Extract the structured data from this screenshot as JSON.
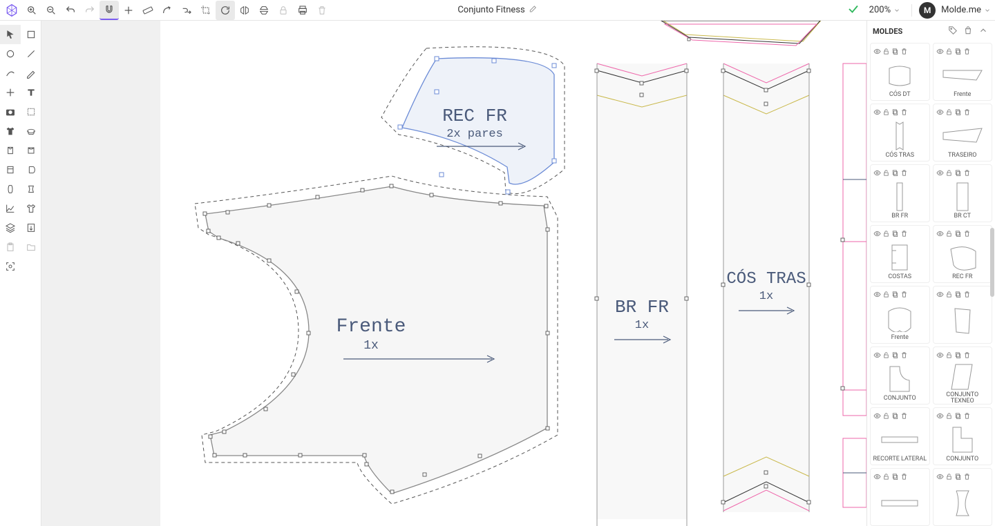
{
  "header": {
    "title": "Conjunto Fitness",
    "zoom": "200%",
    "avatar_initial": "M",
    "brand": "Molde.me"
  },
  "canvas": {
    "rec_fr_title": "REC FR",
    "rec_fr_sub": "2x pares",
    "frente_title": "Frente",
    "frente_sub": "1x",
    "br_fr_title": "BR FR",
    "br_fr_sub": "1x",
    "cos_tras_title": "CÓS TRAS",
    "cos_tras_sub": "1x"
  },
  "right_panel": {
    "title": "MOLDES",
    "items": [
      {
        "label": "CÓS DT"
      },
      {
        "label": "Frente"
      },
      {
        "label": "CÓS TRAS"
      },
      {
        "label": "TRASEIRO"
      },
      {
        "label": "BR FR"
      },
      {
        "label": "BR CT"
      },
      {
        "label": "COSTAS"
      },
      {
        "label": "REC FR"
      },
      {
        "label": "Frente"
      },
      {
        "label": ""
      },
      {
        "label": "CONJUNTO"
      },
      {
        "label": "CONJUNTO TEXNEO"
      },
      {
        "label": "RECORTE LATERAL"
      },
      {
        "label": "CONJUNTO"
      },
      {
        "label": ""
      },
      {
        "label": ""
      }
    ]
  }
}
